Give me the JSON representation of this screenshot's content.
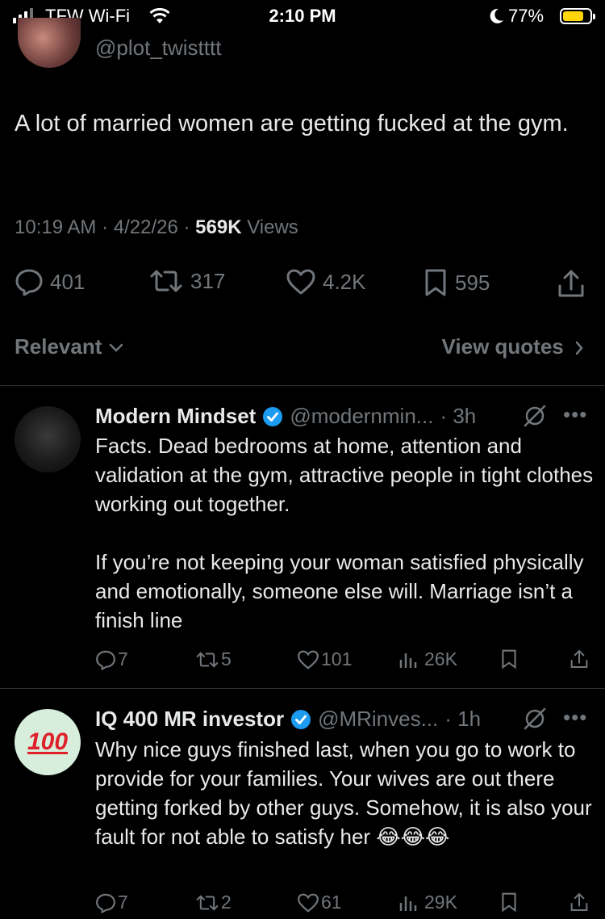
{
  "status_bar": {
    "carrier": "TFW Wi-Fi",
    "time": "2:10 PM",
    "battery_percent": "77%",
    "battery_level": 0.77,
    "icons": [
      "signal-icon",
      "wifi-icon",
      "moon-icon",
      "battery-icon"
    ]
  },
  "main_tweet": {
    "handle": "@plot_twistttt",
    "text": "A lot of married women are getting fucked at the gym.",
    "time": "10:19 AM",
    "date": "4/22/26",
    "views_count": "569K",
    "views_label": "Views",
    "replies": "401",
    "reposts": "317",
    "likes": "4.2K",
    "bookmarks": "595"
  },
  "sort": {
    "label": "Relevant",
    "view_quotes": "View quotes"
  },
  "replies": [
    {
      "name": "Modern Mindset",
      "handle": "@modernmin...",
      "time": "· 3h",
      "text": "Facts. Dead bedrooms at home, attention and validation at the gym, attractive people in tight clothes working out together.\n\nIf you’re not keeping your woman satisfied physically and emotionally, someone else will. Marriage isn’t a finish line",
      "replies": "7",
      "reposts": "5",
      "likes": "101",
      "views": "26K"
    },
    {
      "name": "IQ 400 MR investor",
      "handle": "@MRinves...",
      "time": "· 1h",
      "avatar_text": "100",
      "text": "Why nice guys finished last, when you go to work to provide for your families. Your wives are out there getting forked by other guys. Somehow, it is also your fault for not able to satisfy her 😂😂😂",
      "replies": "7",
      "reposts": "2",
      "likes": "61",
      "views": "29K"
    }
  ],
  "colors": {
    "background": "#000000",
    "text": "#e7e9ea",
    "muted": "#71767b",
    "verified": "#1d9bf0",
    "battery": "#ffd60a",
    "divider": "#2f3336"
  }
}
